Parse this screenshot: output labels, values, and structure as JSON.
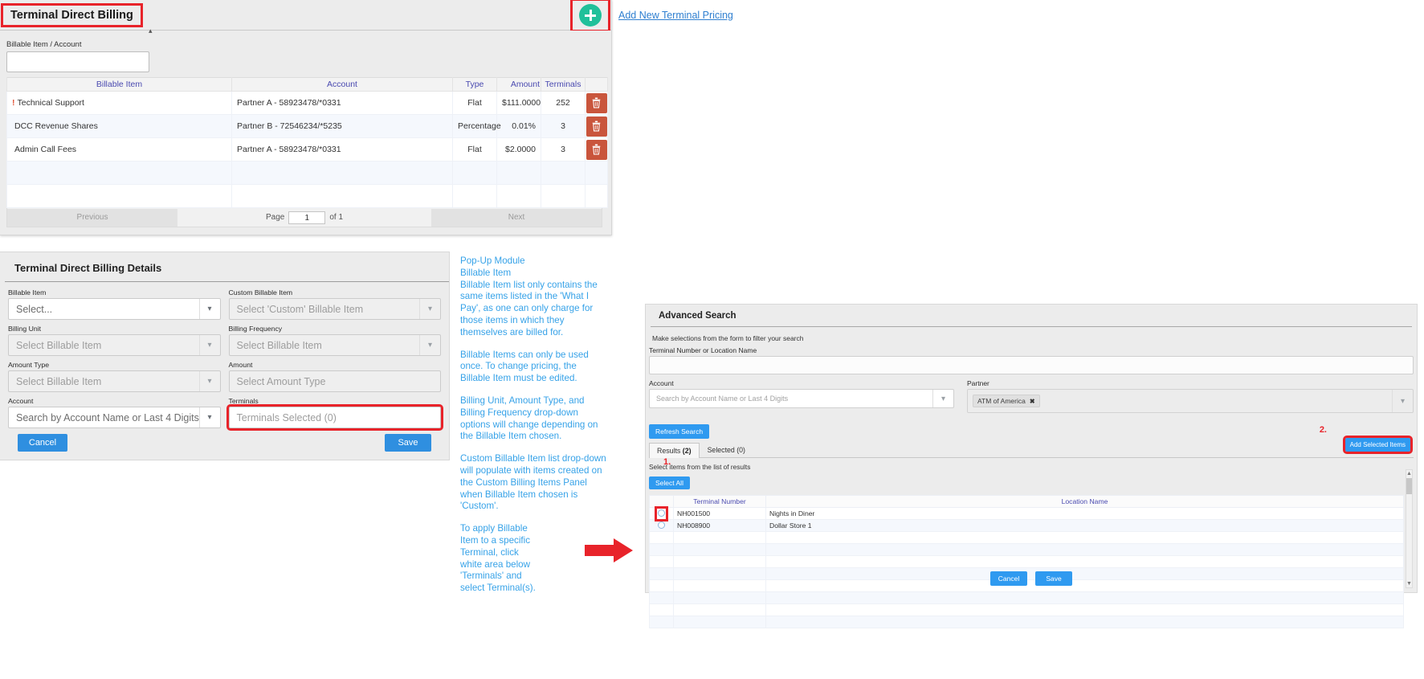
{
  "list_panel": {
    "title": "Terminal Direct Billing",
    "add_new_link": "Add New Terminal Pricing",
    "add_icon": "plus-circle-icon",
    "filter_label": "Billable Item / Account",
    "filter_value": "",
    "columns": [
      "Billable Item",
      "Account",
      "Type",
      "Amount",
      "Terminals"
    ],
    "rows": [
      {
        "warn": "!",
        "item": "Technical Support",
        "account": "Partner A - 58923478/*0331",
        "type": "Flat",
        "amount": "$111.0000",
        "terminals": "252"
      },
      {
        "warn": "",
        "item": "DCC Revenue Shares",
        "account": "Partner B  - 72546234/*5235",
        "type": "Percentage",
        "amount": "0.01%",
        "terminals": "3"
      },
      {
        "warn": "",
        "item": "Admin Call Fees",
        "account": "Partner A - 58923478/*0331",
        "type": "Flat",
        "amount": "$2.0000",
        "terminals": "3"
      }
    ],
    "pager": {
      "previous": "Previous",
      "page_label": "Page",
      "page_value": "1",
      "of_label": "of 1",
      "next": "Next"
    }
  },
  "details_panel": {
    "title": "Terminal Direct Billing Details",
    "fields": {
      "billable_item": {
        "label": "Billable Item",
        "value": "Select..."
      },
      "custom_billable_item": {
        "label": "Custom Billable Item",
        "value": "Select 'Custom' Billable Item"
      },
      "billing_unit": {
        "label": "Billing Unit",
        "value": "Select Billable Item"
      },
      "billing_frequency": {
        "label": "Billing Frequency",
        "value": "Select Billable Item"
      },
      "amount_type": {
        "label": "Amount Type",
        "value": "Select Billable Item"
      },
      "amount": {
        "label": "Amount",
        "value": "Select Amount Type"
      },
      "account": {
        "label": "Account",
        "value": "Search by Account Name or Last 4 Digits"
      },
      "terminals": {
        "label": "Terminals",
        "value": "Terminals Selected (0)"
      }
    },
    "cancel_label": "Cancel",
    "save_label": "Save"
  },
  "annotations": {
    "popup_heading": "Pop-Up Module",
    "billable_item_heading": "Billable Item",
    "para1": "Billable Item list only contains the same items listed in the 'What I Pay', as one can only charge for those items in which they themselves are billed for.",
    "para2": "Billable Items can only be used once.  To change pricing, the Billable Item must be edited.",
    "para3": "Billing Unit, Amount Type, and Billing Frequency drop-down options will change depending on the Billable Item chosen.",
    "para4": "Custom Billable Item list drop-down will populate with items created on the Custom Billing Items Panel when Billable Item chosen is 'Custom'.",
    "para5": "To apply Billable Item to a specific Terminal, click white area below 'Terminals' and select Terminal(s).",
    "arrow_icon": "right-arrow-icon"
  },
  "advanced_search": {
    "title": "Advanced Search",
    "subtitle": "Make selections from the form to filter your search",
    "terminal_field": {
      "label": "Terminal Number or Location Name",
      "value": ""
    },
    "account_field": {
      "label": "Account",
      "value": "Search by Account Name or Last 4 Digits"
    },
    "partner_field": {
      "label": "Partner",
      "chip": "ATM of America",
      "chip_remove": "✖"
    },
    "refresh_label": "Refresh Search",
    "tabs": [
      {
        "label": "Results",
        "count": "(2)",
        "selected": true
      },
      {
        "label": "Selected (0)",
        "count": "",
        "selected": false
      }
    ],
    "select_hint": "Select items from the list of results",
    "select_all_label": "Select All",
    "add_selected_label": "Add Selected Items",
    "step_one": "1.",
    "step_two": "2.",
    "columns": [
      "Terminal Number",
      "Location Name"
    ],
    "rows": [
      {
        "terminal": "NH001500",
        "location": "Nights in Diner"
      },
      {
        "terminal": "NH008900",
        "location": "Dollar Store 1"
      }
    ],
    "cancel_label": "Cancel",
    "save_label": "Save"
  },
  "colors": {
    "accent_blue": "#2f9af0",
    "link_blue": "#2f7fd0",
    "annotation_blue": "#36a2e8",
    "highlight_red": "#e8232a",
    "add_green": "#20c09a",
    "delete_red": "#c9553c",
    "header_purple": "#4a4ab0"
  }
}
